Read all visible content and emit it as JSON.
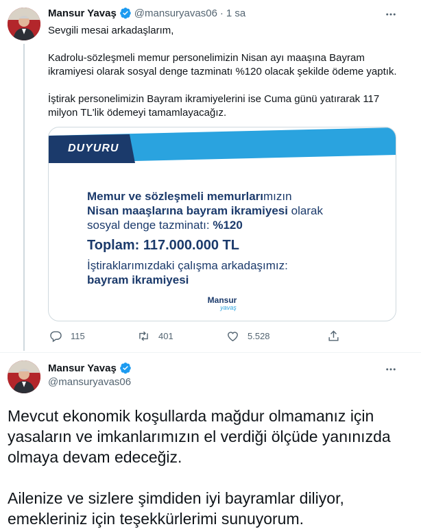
{
  "tweet1": {
    "author_name": "Mansur Yavaş",
    "handle": "@mansuryavas06",
    "separator": "·",
    "time": "1 sa",
    "paragraphs": [
      "Sevgili mesai arkadaşlarım,",
      "Kadrolu-sözleşmeli memur personelimizin Nisan ayı maaşına Bayram ikramiyesi olarak sosyal denge tazminatı %120 olacak şekilde ödeme yaptık.",
      "İştirak personelimizin Bayram ikramiyelerini ise Cuma günü yatırarak 117 milyon TL'lik ödemeyi tamamlayacağız."
    ],
    "card": {
      "banner": "DUYURU",
      "line1_bold": "Memur ve sözleşmeli memurları",
      "line1_rest": "mızın",
      "line2_bold": "Nisan maaşlarına bayram ikramiyesi",
      "line2_rest": " olarak",
      "line3_rest": "sosyal denge tazminatı: ",
      "line3_bold": "%120",
      "total": "Toplam: 117.000.000 TL",
      "line5": "İştiraklarımızdaki çalışma arkadaşımız:",
      "line6": "bayram ikramiyesi",
      "logo_main": "Mansur",
      "logo_script": "yavaş"
    },
    "actions": {
      "replies": "115",
      "retweets": "401",
      "likes": "5.528"
    }
  },
  "tweet2": {
    "author_name": "Mansur Yavaş",
    "handle": "@mansuryavas06",
    "paragraphs": [
      "Mevcut ekonomik koşullarda mağdur olmamanız için yasaların ve imkanlarımızın el verdiği ölçüde yanınızda olmaya devam edeceğiz.",
      "Ailenize ve sizlere şimdiden iyi bayramlar diliyor, emekleriniz için teşekkürlerimi sunuyorum."
    ]
  },
  "icons": {
    "verified": "verified-badge-icon",
    "more": "more-icon",
    "reply": "reply-icon",
    "retweet": "retweet-icon",
    "like": "like-icon",
    "share": "share-icon"
  },
  "colors": {
    "accent": "#1d9bf0",
    "card_navy": "#1b3a6b",
    "card_blue": "#2aa3df",
    "muted": "#536471"
  }
}
